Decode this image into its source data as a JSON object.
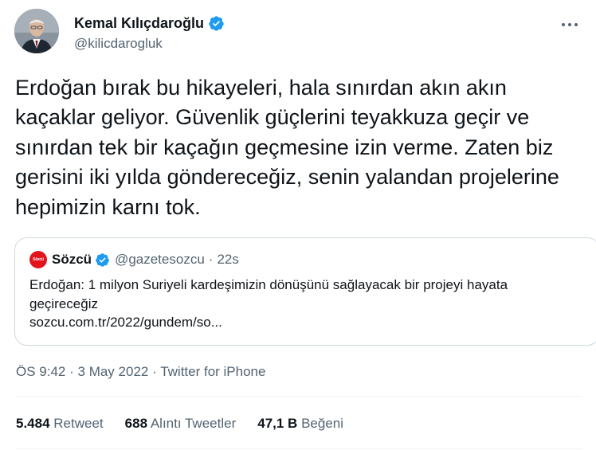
{
  "author": {
    "name": "Kemal Kılıçdaroğlu",
    "handle": "@kilicdarogluk"
  },
  "tweet": {
    "text": "Erdoğan bırak bu hikayeleri, hala sınırdan akın akın kaçaklar geliyor. Güvenlik güçlerini teyakkuza geçir ve sınırdan tek bir kaçağın geçmesine izin verme. Zaten biz gerisini iki yılda göndereceğiz, senin yalandan projelerine hepimizin karnı tok."
  },
  "quote": {
    "logo_text": "Sözcü",
    "name": "Sözcü",
    "handle": "@gazetesozcu",
    "separator": "·",
    "time": "22s",
    "text": "Erdoğan: 1 milyon Suriyeli kardeşimizin dönüşünü sağlayacak bir projeyi hayata geçireceğiz",
    "link": "sozcu.com.tr/2022/gundem/so..."
  },
  "meta": {
    "time": "ÖS 9:42",
    "sep1": "·",
    "date": "3 May 2022",
    "sep2": "·",
    "source": "Twitter for iPhone"
  },
  "stats": [
    {
      "value": "5.484",
      "label": "Retweet"
    },
    {
      "value": "688",
      "label": "Alıntı Tweetler"
    },
    {
      "value": "47,1 B",
      "label": "Beğeni"
    }
  ],
  "colors": {
    "verified": "#1d9bf0",
    "secondary_text": "#536471",
    "border": "#cfd9de",
    "sozcu_red": "#e3131b"
  },
  "icons": {
    "verified": "verified-badge-icon",
    "more": "more-options-icon"
  }
}
